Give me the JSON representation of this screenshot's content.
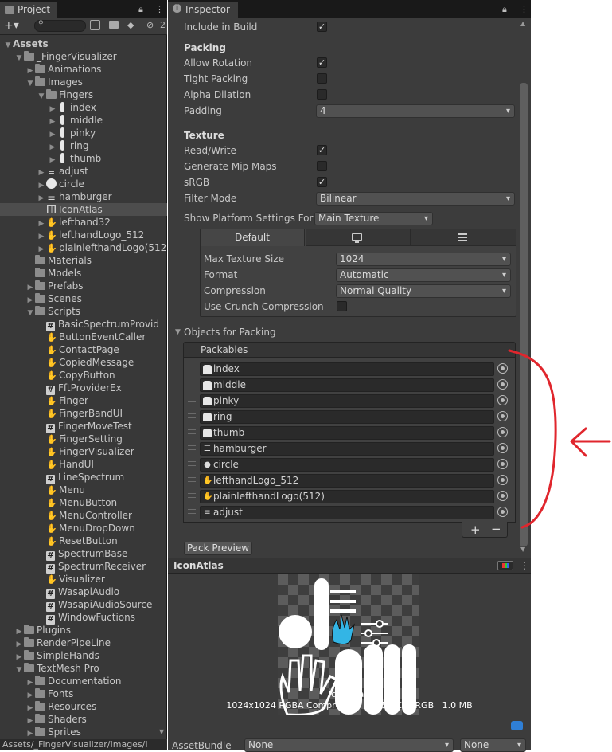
{
  "project": {
    "tab_label": "Project",
    "tab_icon": "folder-icon",
    "search_placeholder": "",
    "hidden_count": "2",
    "tree": [
      {
        "label": "Assets",
        "indent": 0,
        "arrow": "open",
        "icon": "none",
        "bold": true
      },
      {
        "label": "_FingerVisualizer",
        "indent": 1,
        "arrow": "open",
        "icon": "folder"
      },
      {
        "label": "Animations",
        "indent": 2,
        "arrow": "closed",
        "icon": "folder"
      },
      {
        "label": "Images",
        "indent": 2,
        "arrow": "open",
        "icon": "folder"
      },
      {
        "label": "Fingers",
        "indent": 3,
        "arrow": "open",
        "icon": "folder"
      },
      {
        "label": "index",
        "indent": 4,
        "arrow": "closed",
        "icon": "finger"
      },
      {
        "label": "middle",
        "indent": 4,
        "arrow": "closed",
        "icon": "finger"
      },
      {
        "label": "pinky",
        "indent": 4,
        "arrow": "closed",
        "icon": "finger"
      },
      {
        "label": "ring",
        "indent": 4,
        "arrow": "closed",
        "icon": "finger"
      },
      {
        "label": "thumb",
        "indent": 4,
        "arrow": "closed",
        "icon": "finger"
      },
      {
        "label": "adjust",
        "indent": 3,
        "arrow": "closed",
        "icon": "sliders"
      },
      {
        "label": "circle",
        "indent": 3,
        "arrow": "closed",
        "icon": "circle"
      },
      {
        "label": "hamburger",
        "indent": 3,
        "arrow": "closed",
        "icon": "hamburger"
      },
      {
        "label": "IconAtlas",
        "indent": 3,
        "arrow": "none",
        "icon": "atlas",
        "selected": true
      },
      {
        "label": "lefthand32",
        "indent": 3,
        "arrow": "closed",
        "icon": "hand"
      },
      {
        "label": "lefthandLogo_512",
        "indent": 3,
        "arrow": "closed",
        "icon": "hand"
      },
      {
        "label": "plainlefthandLogo(512",
        "indent": 3,
        "arrow": "closed",
        "icon": "handoutline"
      },
      {
        "label": "Materials",
        "indent": 2,
        "arrow": "none",
        "icon": "folder"
      },
      {
        "label": "Models",
        "indent": 2,
        "arrow": "none",
        "icon": "folder"
      },
      {
        "label": "Prefabs",
        "indent": 2,
        "arrow": "closed",
        "icon": "folder"
      },
      {
        "label": "Scenes",
        "indent": 2,
        "arrow": "closed",
        "icon": "folder"
      },
      {
        "label": "Scripts",
        "indent": 2,
        "arrow": "open",
        "icon": "folder"
      },
      {
        "label": "BasicSpectrumProvid",
        "indent": 3,
        "arrow": "none",
        "icon": "hash"
      },
      {
        "label": "ButtonEventCaller",
        "indent": 3,
        "arrow": "none",
        "icon": "hand"
      },
      {
        "label": "ContactPage",
        "indent": 3,
        "arrow": "none",
        "icon": "hand"
      },
      {
        "label": "CopiedMessage",
        "indent": 3,
        "arrow": "none",
        "icon": "hand"
      },
      {
        "label": "CopyButton",
        "indent": 3,
        "arrow": "none",
        "icon": "hand"
      },
      {
        "label": "FftProviderEx",
        "indent": 3,
        "arrow": "none",
        "icon": "hash"
      },
      {
        "label": "Finger",
        "indent": 3,
        "arrow": "none",
        "icon": "hand"
      },
      {
        "label": "FingerBandUI",
        "indent": 3,
        "arrow": "none",
        "icon": "hand"
      },
      {
        "label": "FingerMoveTest",
        "indent": 3,
        "arrow": "none",
        "icon": "hash"
      },
      {
        "label": "FingerSetting",
        "indent": 3,
        "arrow": "none",
        "icon": "hand"
      },
      {
        "label": "FingerVisualizer",
        "indent": 3,
        "arrow": "none",
        "icon": "hand"
      },
      {
        "label": "HandUI",
        "indent": 3,
        "arrow": "none",
        "icon": "hand"
      },
      {
        "label": "LineSpectrum",
        "indent": 3,
        "arrow": "none",
        "icon": "hash"
      },
      {
        "label": "Menu",
        "indent": 3,
        "arrow": "none",
        "icon": "hand"
      },
      {
        "label": "MenuButton",
        "indent": 3,
        "arrow": "none",
        "icon": "hand"
      },
      {
        "label": "MenuController",
        "indent": 3,
        "arrow": "none",
        "icon": "hand"
      },
      {
        "label": "MenuDropDown",
        "indent": 3,
        "arrow": "none",
        "icon": "hand"
      },
      {
        "label": "ResetButton",
        "indent": 3,
        "arrow": "none",
        "icon": "hand"
      },
      {
        "label": "SpectrumBase",
        "indent": 3,
        "arrow": "none",
        "icon": "hash"
      },
      {
        "label": "SpectrumReceiver",
        "indent": 3,
        "arrow": "none",
        "icon": "hash"
      },
      {
        "label": "Visualizer",
        "indent": 3,
        "arrow": "none",
        "icon": "hand"
      },
      {
        "label": "WasapiAudio",
        "indent": 3,
        "arrow": "none",
        "icon": "hash"
      },
      {
        "label": "WasapiAudioSource",
        "indent": 3,
        "arrow": "none",
        "icon": "hash"
      },
      {
        "label": "WindowFuctions",
        "indent": 3,
        "arrow": "none",
        "icon": "hash"
      },
      {
        "label": "Plugins",
        "indent": 1,
        "arrow": "closed",
        "icon": "folder"
      },
      {
        "label": "RenderPipeLine",
        "indent": 1,
        "arrow": "closed",
        "icon": "folder"
      },
      {
        "label": "SimpleHands",
        "indent": 1,
        "arrow": "closed",
        "icon": "folder"
      },
      {
        "label": "TextMesh Pro",
        "indent": 1,
        "arrow": "open",
        "icon": "folder"
      },
      {
        "label": "Documentation",
        "indent": 2,
        "arrow": "closed",
        "icon": "folder"
      },
      {
        "label": "Fonts",
        "indent": 2,
        "arrow": "closed",
        "icon": "folder"
      },
      {
        "label": "Resources",
        "indent": 2,
        "arrow": "closed",
        "icon": "folder"
      },
      {
        "label": "Shaders",
        "indent": 2,
        "arrow": "closed",
        "icon": "folder"
      },
      {
        "label": "Sprites",
        "indent": 2,
        "arrow": "closed",
        "icon": "folder"
      }
    ],
    "path": "Assets/_FingerVisualizer/Images/I"
  },
  "inspector": {
    "tab_label": "Inspector",
    "include_in_build": {
      "label": "Include in Build",
      "checked": true
    },
    "packing": {
      "header": "Packing",
      "allow_rotation": {
        "label": "Allow Rotation",
        "checked": true
      },
      "tight_packing": {
        "label": "Tight Packing",
        "checked": false
      },
      "alpha_dilation": {
        "label": "Alpha Dilation",
        "checked": false
      },
      "padding": {
        "label": "Padding",
        "value": "4"
      }
    },
    "texture": {
      "header": "Texture",
      "read_write": {
        "label": "Read/Write",
        "checked": true
      },
      "mip_maps": {
        "label": "Generate Mip Maps",
        "checked": false
      },
      "srgb": {
        "label": "sRGB",
        "checked": true
      },
      "filter_mode": {
        "label": "Filter Mode",
        "value": "Bilinear"
      }
    },
    "platform": {
      "label": "Show Platform Settings For",
      "value": "Main Texture",
      "tabs": [
        "Default",
        "monitor-icon",
        "grid-icon"
      ],
      "max_size": {
        "label": "Max Texture Size",
        "value": "1024"
      },
      "format": {
        "label": "Format",
        "value": "Automatic"
      },
      "compression": {
        "label": "Compression",
        "value": "Normal Quality"
      },
      "crunch": {
        "label": "Use Crunch Compression",
        "checked": false
      }
    },
    "objects": {
      "header": "Objects for Packing",
      "list_header": "Packables",
      "items": [
        {
          "label": "index",
          "icon": "finger"
        },
        {
          "label": "middle",
          "icon": "finger"
        },
        {
          "label": "pinky",
          "icon": "finger"
        },
        {
          "label": "ring",
          "icon": "finger"
        },
        {
          "label": "thumb",
          "icon": "finger"
        },
        {
          "label": "hamburger",
          "icon": "hamburger"
        },
        {
          "label": "circle",
          "icon": "circle"
        },
        {
          "label": "lefthandLogo_512",
          "icon": "hand"
        },
        {
          "label": "plainlefthandLogo(512)",
          "icon": "handoutline"
        },
        {
          "label": "adjust",
          "icon": "sliders"
        }
      ],
      "add_label": "+",
      "remove_label": "−"
    },
    "pack_preview_label": "Pack Preview"
  },
  "preview": {
    "title": "IconAtlas",
    "name": "IconAtlas",
    "info": "1024x1024 RGBA Compressed DXT5|BC3 sRGB   1.0 MB",
    "assetbundle_label": "AssetBundle",
    "assetbundle_value": "None",
    "variant_value": "None"
  },
  "annotation": {
    "color": "#e0262d"
  }
}
